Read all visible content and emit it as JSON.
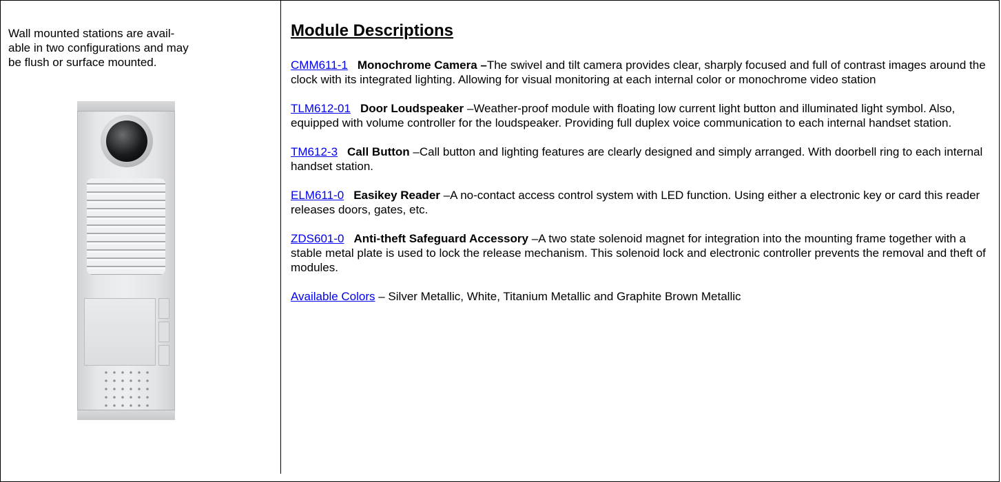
{
  "intro": "Wall mounted stations are avail-\nable in two configurations and may\nbe flush or surface mounted.",
  "heading": "Module Descriptions",
  "modules": [
    {
      "code": "CMM611-1",
      "name": "Monochrome Camera –",
      "desc": "The swivel and tilt camera provides clear, sharply focused and full of contrast images around the clock with its integrated lighting.  Allowing for visual monitoring at each internal color or monochrome video station"
    },
    {
      "code": "TLM612-01",
      "name": "Door Loudspeaker",
      "desc": " –Weather-proof module with floating low current light button and illuminated light symbol.  Also, equipped with volume controller for the loudspeaker. Providing full duplex voice communication to each internal handset station."
    },
    {
      "code": "TM612-3",
      "name": "Call Button",
      "desc": " –Call button and lighting features are clearly designed and simply arranged. With doorbell ring to each internal handset station."
    },
    {
      "code": "ELM611-0",
      "name": "Easikey Reader",
      "desc": " –A no-contact access control system with LED function.  Using either a electronic key or card this reader releases doors, gates, etc."
    },
    {
      "code": "ZDS601-0",
      "name": "Anti-theft Safeguard Accessory",
      "desc": " –A two state solenoid magnet for integration into the mounting frame together with a stable metal plate is used to lock the release mechanism. This solenoid lock and electronic controller prevents the removal and theft of modules."
    }
  ],
  "colors": {
    "link": "Available Colors",
    "desc": " – Silver Metallic, White, Titanium Metallic and Graphite Brown Metallic"
  }
}
